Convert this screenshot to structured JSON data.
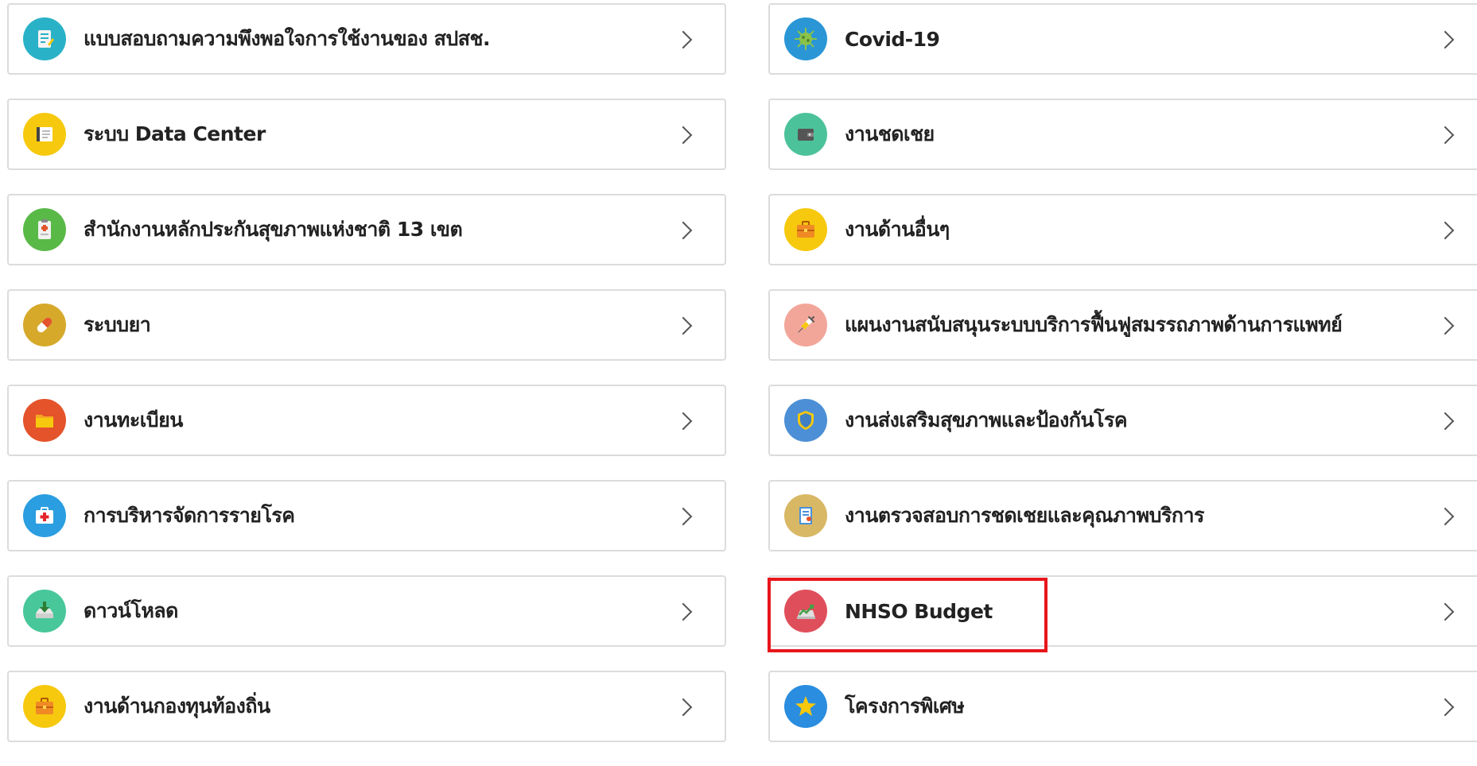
{
  "menu": {
    "left": [
      {
        "label": "แบบสอบถามความพึงพอใจการใช้งานของ สปสช.",
        "icon": "survey-icon",
        "color": "#29b2c7"
      },
      {
        "label": "ระบบ Data Center",
        "icon": "data-center-icon",
        "color": "#f6c90e"
      },
      {
        "label": "สำนักงานหลักประกันสุขภาพแห่งชาติ 13 เขต",
        "icon": "clipboard-icon",
        "color": "#59b947"
      },
      {
        "label": "ระบบยา",
        "icon": "pill-icon",
        "color": "#d6a92b"
      },
      {
        "label": "งานทะเบียน",
        "icon": "folder-icon",
        "color": "#e4532a"
      },
      {
        "label": "การบริหารจัดการรายโรค",
        "icon": "first-aid-icon",
        "color": "#2a9ee0"
      },
      {
        "label": "ดาวน์โหลด",
        "icon": "download-icon",
        "color": "#48c79a"
      },
      {
        "label": "งานด้านกองทุนท้องถิ่น",
        "icon": "briefcase-icon",
        "color": "#f6c90e"
      }
    ],
    "right": [
      {
        "label": "Covid-19",
        "icon": "virus-icon",
        "color": "#2a96d6"
      },
      {
        "label": "งานชดเชย",
        "icon": "wallet-icon",
        "color": "#4cc29a"
      },
      {
        "label": "งานด้านอื่นๆ",
        "icon": "briefcase-icon",
        "color": "#f6c90e"
      },
      {
        "label": "แผนงานสนับสนุนระบบบริการฟื้นฟูสมรรถภาพด้านการแพทย์",
        "icon": "syringe-icon",
        "color": "#f2a69a"
      },
      {
        "label": "งานส่งเสริมสุขภาพและป้องกันโรค",
        "icon": "shield-icon",
        "color": "#4d8fd6"
      },
      {
        "label": "งานตรวจสอบการชดเชยและคุณภาพบริการ",
        "icon": "audit-icon",
        "color": "#d9b865"
      },
      {
        "label": "NHSO Budget",
        "icon": "budget-chart-icon",
        "color": "#df4f5b"
      },
      {
        "label": "โครงการพิเศษ",
        "icon": "star-icon",
        "color": "#2a8de0"
      }
    ]
  },
  "highlight": {
    "color": "#e8161b",
    "target": "NHSO Budget"
  }
}
